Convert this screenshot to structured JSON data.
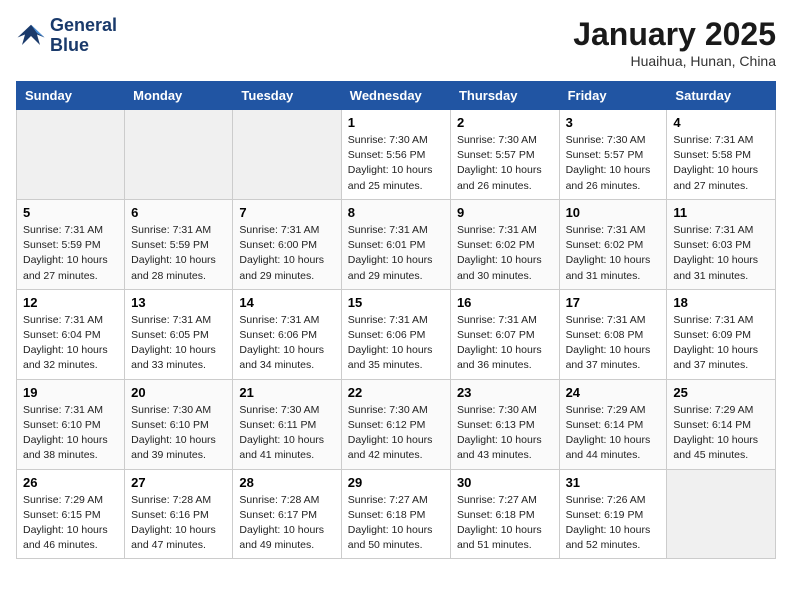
{
  "header": {
    "logo_line1": "General",
    "logo_line2": "Blue",
    "month_title": "January 2025",
    "location": "Huaihua, Hunan, China"
  },
  "weekdays": [
    "Sunday",
    "Monday",
    "Tuesday",
    "Wednesday",
    "Thursday",
    "Friday",
    "Saturday"
  ],
  "weeks": [
    [
      {
        "day": "",
        "empty": true
      },
      {
        "day": "",
        "empty": true
      },
      {
        "day": "",
        "empty": true
      },
      {
        "day": "1",
        "sunrise": "7:30 AM",
        "sunset": "5:56 PM",
        "daylight": "10 hours and 25 minutes."
      },
      {
        "day": "2",
        "sunrise": "7:30 AM",
        "sunset": "5:57 PM",
        "daylight": "10 hours and 26 minutes."
      },
      {
        "day": "3",
        "sunrise": "7:30 AM",
        "sunset": "5:57 PM",
        "daylight": "10 hours and 26 minutes."
      },
      {
        "day": "4",
        "sunrise": "7:31 AM",
        "sunset": "5:58 PM",
        "daylight": "10 hours and 27 minutes."
      }
    ],
    [
      {
        "day": "5",
        "sunrise": "7:31 AM",
        "sunset": "5:59 PM",
        "daylight": "10 hours and 27 minutes."
      },
      {
        "day": "6",
        "sunrise": "7:31 AM",
        "sunset": "5:59 PM",
        "daylight": "10 hours and 28 minutes."
      },
      {
        "day": "7",
        "sunrise": "7:31 AM",
        "sunset": "6:00 PM",
        "daylight": "10 hours and 29 minutes."
      },
      {
        "day": "8",
        "sunrise": "7:31 AM",
        "sunset": "6:01 PM",
        "daylight": "10 hours and 29 minutes."
      },
      {
        "day": "9",
        "sunrise": "7:31 AM",
        "sunset": "6:02 PM",
        "daylight": "10 hours and 30 minutes."
      },
      {
        "day": "10",
        "sunrise": "7:31 AM",
        "sunset": "6:02 PM",
        "daylight": "10 hours and 31 minutes."
      },
      {
        "day": "11",
        "sunrise": "7:31 AM",
        "sunset": "6:03 PM",
        "daylight": "10 hours and 31 minutes."
      }
    ],
    [
      {
        "day": "12",
        "sunrise": "7:31 AM",
        "sunset": "6:04 PM",
        "daylight": "10 hours and 32 minutes."
      },
      {
        "day": "13",
        "sunrise": "7:31 AM",
        "sunset": "6:05 PM",
        "daylight": "10 hours and 33 minutes."
      },
      {
        "day": "14",
        "sunrise": "7:31 AM",
        "sunset": "6:06 PM",
        "daylight": "10 hours and 34 minutes."
      },
      {
        "day": "15",
        "sunrise": "7:31 AM",
        "sunset": "6:06 PM",
        "daylight": "10 hours and 35 minutes."
      },
      {
        "day": "16",
        "sunrise": "7:31 AM",
        "sunset": "6:07 PM",
        "daylight": "10 hours and 36 minutes."
      },
      {
        "day": "17",
        "sunrise": "7:31 AM",
        "sunset": "6:08 PM",
        "daylight": "10 hours and 37 minutes."
      },
      {
        "day": "18",
        "sunrise": "7:31 AM",
        "sunset": "6:09 PM",
        "daylight": "10 hours and 37 minutes."
      }
    ],
    [
      {
        "day": "19",
        "sunrise": "7:31 AM",
        "sunset": "6:10 PM",
        "daylight": "10 hours and 38 minutes."
      },
      {
        "day": "20",
        "sunrise": "7:30 AM",
        "sunset": "6:10 PM",
        "daylight": "10 hours and 39 minutes."
      },
      {
        "day": "21",
        "sunrise": "7:30 AM",
        "sunset": "6:11 PM",
        "daylight": "10 hours and 41 minutes."
      },
      {
        "day": "22",
        "sunrise": "7:30 AM",
        "sunset": "6:12 PM",
        "daylight": "10 hours and 42 minutes."
      },
      {
        "day": "23",
        "sunrise": "7:30 AM",
        "sunset": "6:13 PM",
        "daylight": "10 hours and 43 minutes."
      },
      {
        "day": "24",
        "sunrise": "7:29 AM",
        "sunset": "6:14 PM",
        "daylight": "10 hours and 44 minutes."
      },
      {
        "day": "25",
        "sunrise": "7:29 AM",
        "sunset": "6:14 PM",
        "daylight": "10 hours and 45 minutes."
      }
    ],
    [
      {
        "day": "26",
        "sunrise": "7:29 AM",
        "sunset": "6:15 PM",
        "daylight": "10 hours and 46 minutes."
      },
      {
        "day": "27",
        "sunrise": "7:28 AM",
        "sunset": "6:16 PM",
        "daylight": "10 hours and 47 minutes."
      },
      {
        "day": "28",
        "sunrise": "7:28 AM",
        "sunset": "6:17 PM",
        "daylight": "10 hours and 49 minutes."
      },
      {
        "day": "29",
        "sunrise": "7:27 AM",
        "sunset": "6:18 PM",
        "daylight": "10 hours and 50 minutes."
      },
      {
        "day": "30",
        "sunrise": "7:27 AM",
        "sunset": "6:18 PM",
        "daylight": "10 hours and 51 minutes."
      },
      {
        "day": "31",
        "sunrise": "7:26 AM",
        "sunset": "6:19 PM",
        "daylight": "10 hours and 52 minutes."
      },
      {
        "day": "",
        "empty": true
      }
    ]
  ]
}
